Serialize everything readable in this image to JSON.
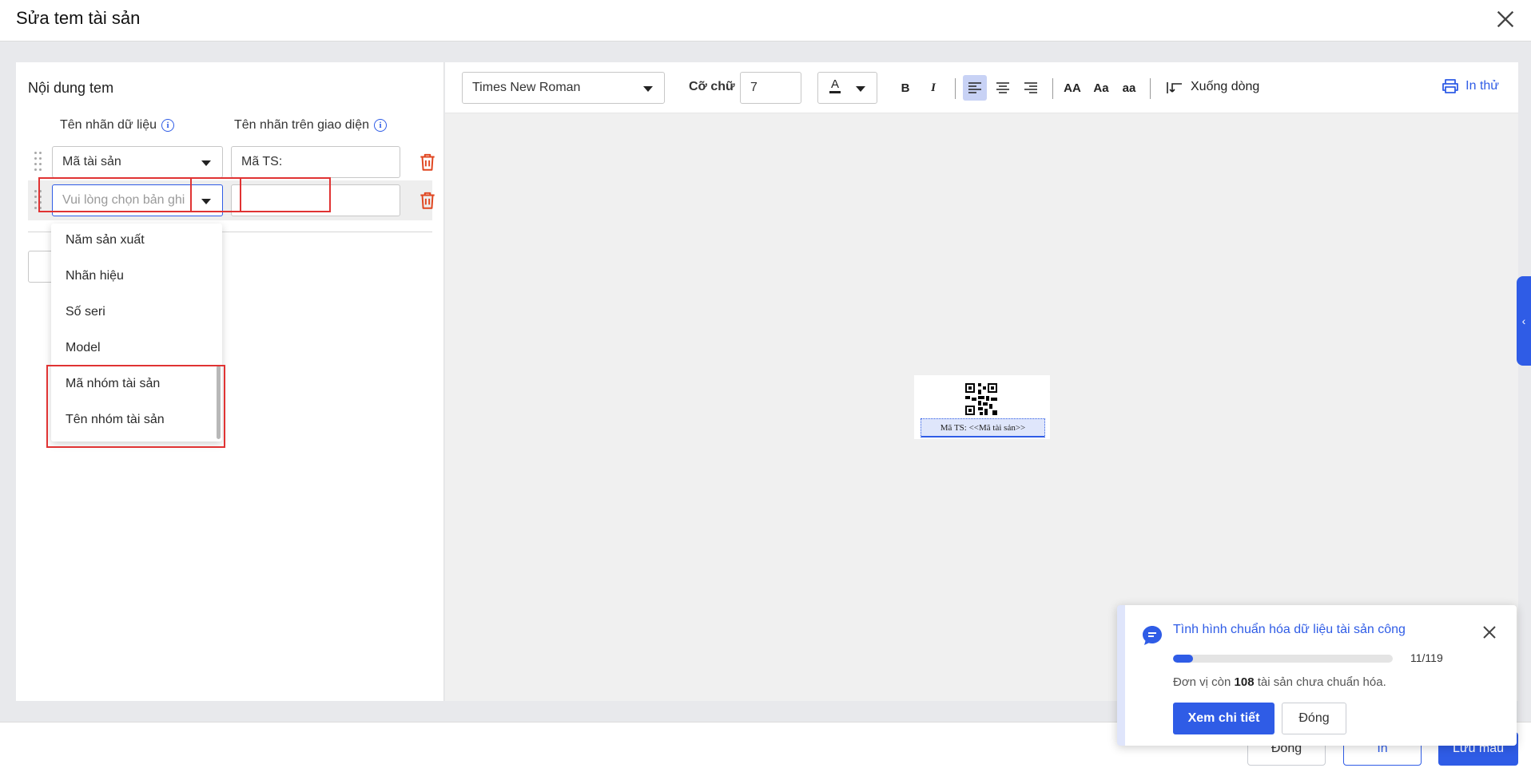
{
  "dialog": {
    "title": "Sửa tem tài sản"
  },
  "left_panel": {
    "heading": "Nội dung tem",
    "col_data_label": "Tên nhãn dữ liệu",
    "col_ui_label": "Tên nhãn trên giao diện",
    "rows": [
      {
        "field": "Mã tài sản",
        "ui_label": "Mã TS:"
      },
      {
        "field_placeholder": "Vui lòng chọn bản ghi",
        "ui_label": ""
      }
    ],
    "dropdown_options": [
      "Năm sản xuất",
      "Nhãn hiệu",
      "Số seri",
      "Model",
      "Mã nhóm tài sản",
      "Tên nhóm tài sản"
    ]
  },
  "toolbar": {
    "font": "Times New Roman",
    "size_label": "Cỡ chữ",
    "size_value": "7",
    "color_letter": "A",
    "bold": "B",
    "italic": "I",
    "upper": "AA",
    "title_case": "Aa",
    "lower": "aa",
    "wrap": "Xuống dòng",
    "print_test": "In thử"
  },
  "preview": {
    "label_text": "Mã TS: <<Mã tài sản>>"
  },
  "footer": {
    "close": "Đóng",
    "print": "In",
    "save": "Lưu mẫu"
  },
  "toast": {
    "title": "Tình hình chuẩn hóa dữ liệu tài sản công",
    "progress_value": 11,
    "progress_total": 119,
    "progress_text": "11/119",
    "msg_prefix": "Đơn vị còn",
    "msg_count": "108",
    "msg_suffix": "tài sản chưa chuẩn hóa.",
    "detail_button": "Xem chi tiết",
    "close_button": "Đóng"
  },
  "colors": {
    "primary": "#2f5ce6",
    "danger": "#e03333"
  }
}
